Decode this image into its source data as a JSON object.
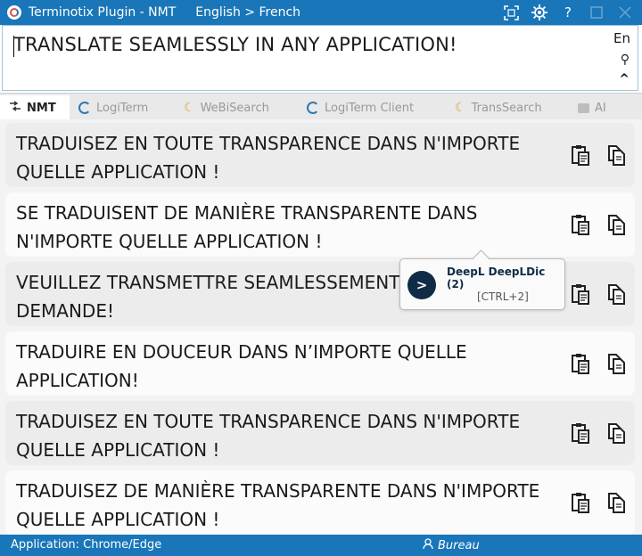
{
  "window": {
    "title": "Terminotix Plugin - NMT",
    "language_pair": "English > French",
    "icons": [
      "screenshot-icon",
      "settings-icon",
      "help-icon",
      "maximize-icon",
      "close-icon"
    ],
    "help_label": "?"
  },
  "source": {
    "text": "TRANSLATE SEAMLESSLY IN ANY APPLICATION!",
    "lang": "En",
    "search_glyph": "⚲",
    "collapse_glyph": "^"
  },
  "tabs": [
    {
      "label": "NMT",
      "icon": "nmt-icon",
      "active": true
    },
    {
      "label": "LogiTerm",
      "icon": "logiterm-icon",
      "active": false
    },
    {
      "label": "WeBiSearch",
      "icon": "webisearch-icon",
      "active": false
    },
    {
      "label": "LogiTerm Client",
      "icon": "logiterm-client-icon",
      "active": false
    },
    {
      "label": "TransSearch",
      "icon": "transsearch-icon",
      "active": false
    },
    {
      "label": "AI",
      "icon": "ai-icon",
      "active": false
    }
  ],
  "results": [
    {
      "text": "TRADUISEZ EN TOUTE TRANSPARENCE DANS N'IMPORTE QUELLE APPLICATION !"
    },
    {
      "text": "SE TRADUISENT DE MANIÈRE TRANSPARENTE DANS N'IMPORTE QUELLE APPLICATION !"
    },
    {
      "text": "VEUILLEZ TRANSMETTRE SEAMLESSEMENT DANS TOUTE DEMANDE!"
    },
    {
      "text": "TRADUIRE EN DOUCEUR DANS N’IMPORTE QUELLE APPLICATION!"
    },
    {
      "text": "TRADUISEZ EN TOUTE TRANSPARENCE DANS N'IMPORTE QUELLE APPLICATION !"
    },
    {
      "text": "TRADUISEZ DE MANIÈRE TRANSPARENTE DANS N'IMPORTE QUELLE APPLICATION !"
    }
  ],
  "tooltip": {
    "engine": "DeepL DeepLDic (2)",
    "shortcut": "[CTRL+2]",
    "logo_glyph": ">"
  },
  "status": {
    "application": "Application: Chrome/Edge",
    "user": "Bureau"
  },
  "colors": {
    "accent": "#1976b8",
    "deepl_navy": "#0f2b46"
  }
}
